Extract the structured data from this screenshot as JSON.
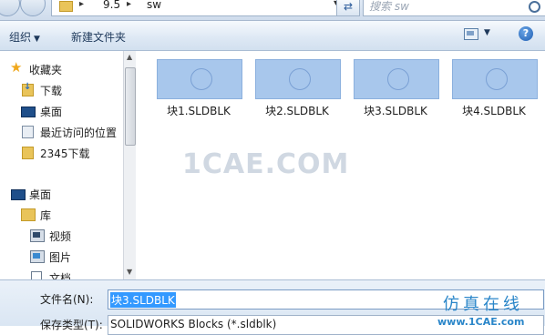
{
  "address": {
    "crumbs": [
      "9.5",
      "sw"
    ],
    "search_placeholder": "搜索 sw"
  },
  "toolbar": {
    "organize": "组织",
    "new_folder": "新建文件夹"
  },
  "nav": {
    "items": [
      {
        "label": "收藏夹",
        "icon": "star-icon"
      },
      {
        "label": "下载",
        "icon": "download-folder-icon"
      },
      {
        "label": "桌面",
        "icon": "desktop-icon"
      },
      {
        "label": "最近访问的位置",
        "icon": "recent-places-icon"
      },
      {
        "label": "2345下载",
        "icon": "folder-icon"
      },
      {
        "label": "桌面",
        "icon": "desktop-icon"
      },
      {
        "label": "库",
        "icon": "library-icon"
      },
      {
        "label": "视频",
        "icon": "video-icon"
      },
      {
        "label": "图片",
        "icon": "pictures-icon"
      },
      {
        "label": "文档",
        "icon": "documents-icon"
      }
    ]
  },
  "files": [
    {
      "name": "块1.SLDBLK"
    },
    {
      "name": "块2.SLDBLK"
    },
    {
      "name": "块3.SLDBLK"
    },
    {
      "name": "块4.SLDBLK"
    }
  ],
  "watermark": "1CAE.COM",
  "bottom": {
    "filename_label": "文件名(N):",
    "filename_value": "块3.SLDBLK",
    "type_label": "保存类型(T):",
    "type_value": "SOLIDWORKS Blocks (*.sldblk)",
    "brand": "仿真在线",
    "site": "www.1CAE.com"
  }
}
